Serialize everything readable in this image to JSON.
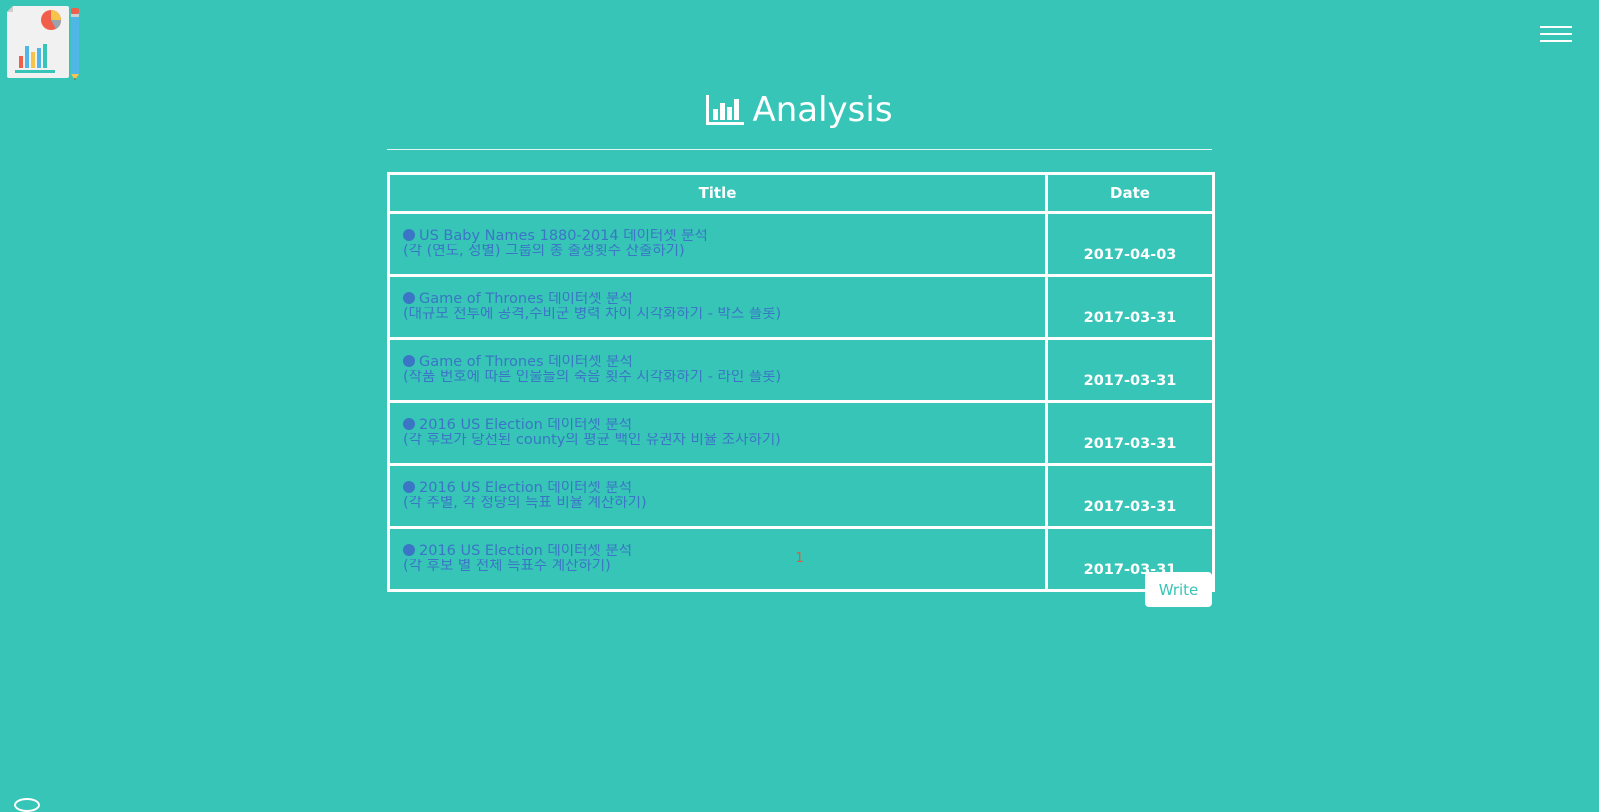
{
  "header": {
    "logo_icon": "report-chart-pencil-icon",
    "menu_icon": "hamburger-menu-icon"
  },
  "page": {
    "title": "Analysis",
    "title_icon": "bar-chart-icon"
  },
  "table": {
    "columns": [
      "Title",
      "Date"
    ],
    "rows": [
      {
        "title_line1": "US Baby Names 1880-2014 데이터셋 분석",
        "title_line2": "(각 (연도, 성별) 그룹의 총 출생횟수 산출하기)",
        "date": "2017-04-03"
      },
      {
        "title_line1": "Game of Thrones 데이터셋 분석",
        "title_line2": "(대규모 전투에 공격,수비군 병력 차이 시각화하기 - 박스 플롯)",
        "date": "2017-03-31"
      },
      {
        "title_line1": "Game of Thrones 데이터셋 분석",
        "title_line2": "(작품 번호에 따른 인물들의 죽음 횟수 시각화하기 - 라인 플롯)",
        "date": "2017-03-31"
      },
      {
        "title_line1": "2016 US Election 데이터셋 분석",
        "title_line2": "(각 후보가 당선된 county의 평균 백인 유권자 비율 조사하기)",
        "date": "2017-03-31"
      },
      {
        "title_line1": "2016 US Election 데이터셋 분석",
        "title_line2": "(각 주별, 각 정당의 득표 비율 계산하기)",
        "date": "2017-03-31"
      },
      {
        "title_line1": "2016 US Election 데이터셋 분석",
        "title_line2": "(각 후보 별 전체 득표수 계산하기)",
        "date": "2017-03-31"
      }
    ]
  },
  "pagination": {
    "current_page": "1"
  },
  "actions": {
    "write_label": "Write"
  },
  "colors": {
    "background": "#37c5b8",
    "link": "#3a76c5",
    "page_number": "#e05a3a",
    "button_text": "#37c5b8"
  }
}
